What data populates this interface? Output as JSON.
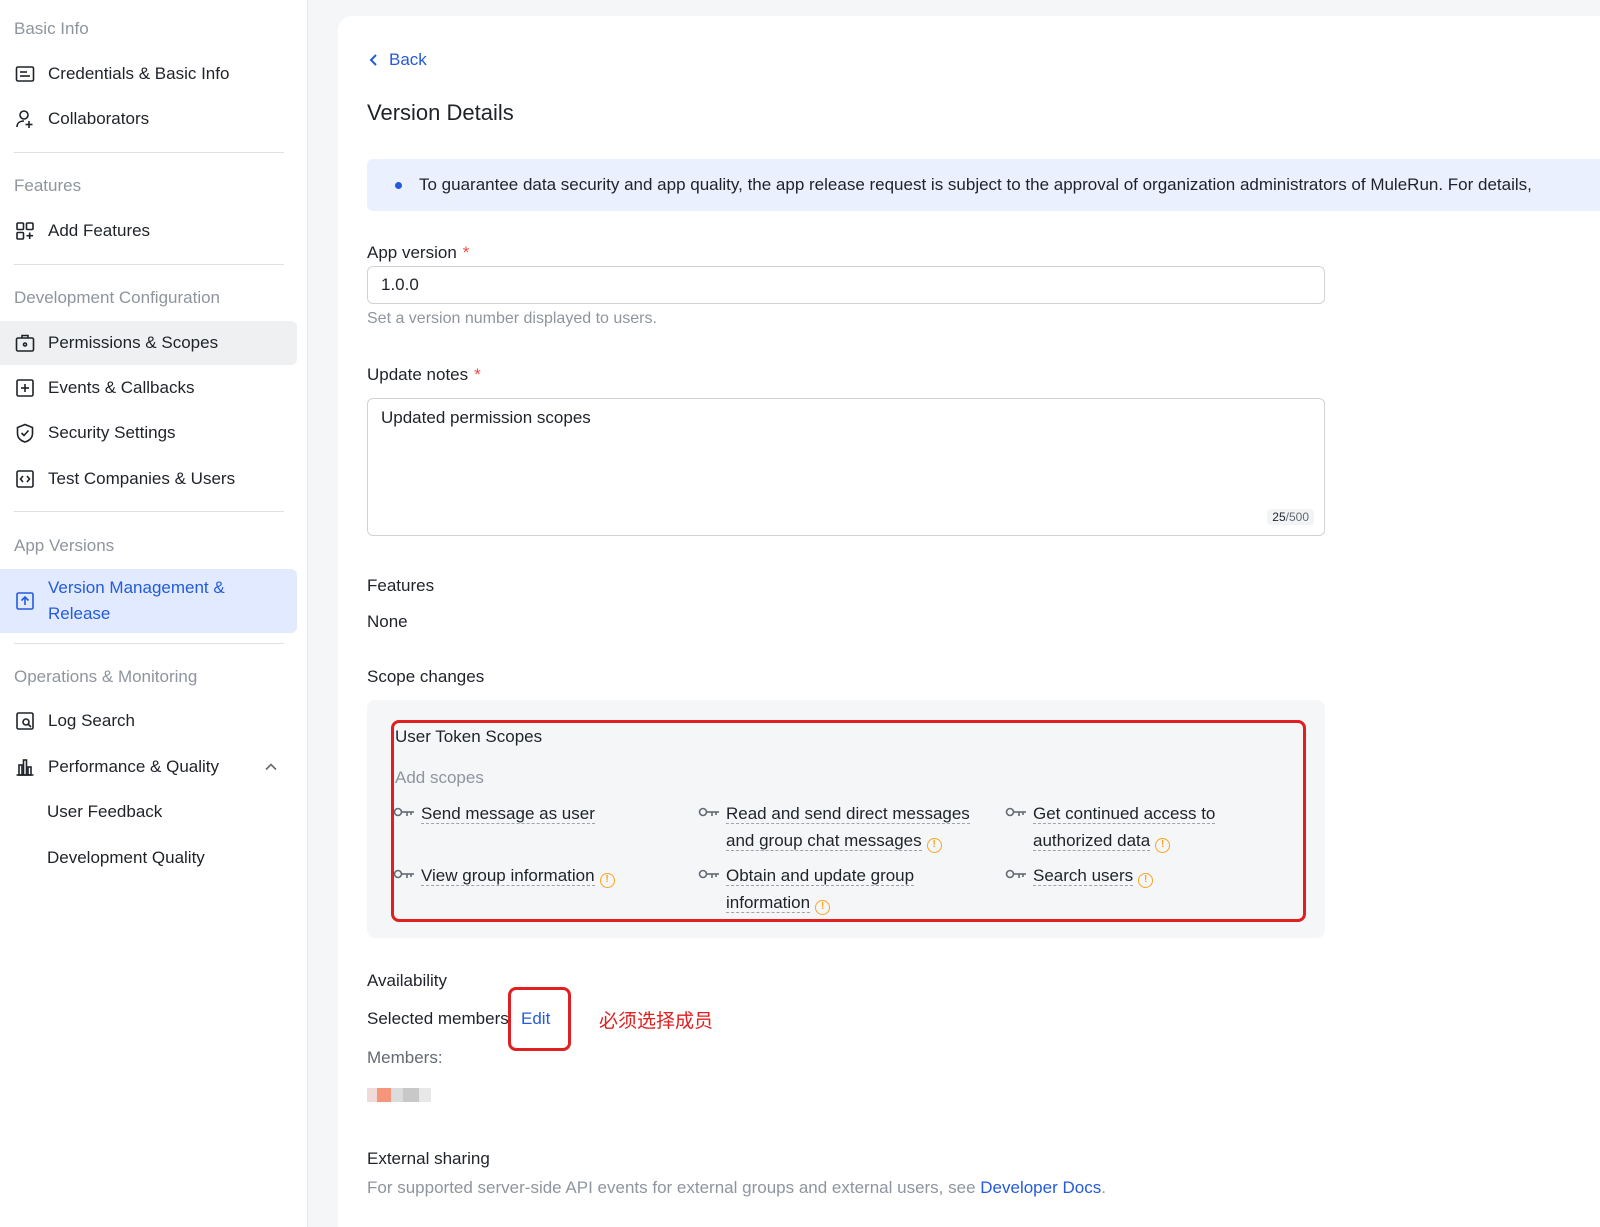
{
  "sidebar": {
    "sections": [
      {
        "title": "Basic Info"
      },
      {
        "title": "Features"
      },
      {
        "title": "Development Configuration"
      },
      {
        "title": "App Versions"
      },
      {
        "title": "Operations & Monitoring"
      }
    ],
    "items": {
      "credentials": "Credentials & Basic Info",
      "collaborators": "Collaborators",
      "add_features": "Add Features",
      "permissions": "Permissions & Scopes",
      "events": "Events & Callbacks",
      "security": "Security Settings",
      "test_companies": "Test Companies & Users",
      "version_mgmt": "Version Management & Release",
      "log_search": "Log Search",
      "performance": "Performance & Quality",
      "user_feedback": "User Feedback",
      "dev_quality": "Development Quality"
    }
  },
  "main": {
    "back_label": "Back",
    "title": "Version Details",
    "notice": "To guarantee data security and app quality, the app release request is subject to the approval of organization administrators of MuleRun. For details,",
    "app_version": {
      "label": "App version",
      "required_mark": "*",
      "value": "1.0.0",
      "help": "Set a version number displayed to users."
    },
    "update_notes": {
      "label": "Update notes",
      "required_mark": "*",
      "value": "Updated permission scopes",
      "count": "25",
      "max": "/500"
    },
    "features": {
      "label": "Features",
      "value": "None"
    },
    "scope_changes": {
      "label": "Scope changes",
      "group_title": "User Token Scopes",
      "add_label": "Add scopes",
      "scopes": [
        {
          "line1": "Send message as user",
          "line2": "",
          "warn": false
        },
        {
          "line1": "Read and send direct messages",
          "line2": "and group chat messages",
          "warn": true
        },
        {
          "line1": "Get continued access to",
          "line2": "authorized data",
          "warn": true
        },
        {
          "line1": "View group information",
          "line2": "",
          "warn": true
        },
        {
          "line1": "Obtain and update group",
          "line2": "information",
          "warn": true
        },
        {
          "line1": "Search users",
          "line2": "",
          "warn": true
        }
      ]
    },
    "availability": {
      "label": "Availability",
      "selected": "Selected members",
      "edit": "Edit",
      "annotation": "必须选择成员",
      "members_label": "Members:"
    },
    "external_sharing": {
      "label": "External sharing",
      "help_prefix": "For supported server-side API events for external groups and external users, see ",
      "help_link": "Developer Docs",
      "help_suffix": "."
    }
  },
  "colors": {
    "accent": "#245bdb",
    "active_bg": "#e1eaff",
    "annotation": "#e02020",
    "warning": "#f5a524"
  }
}
